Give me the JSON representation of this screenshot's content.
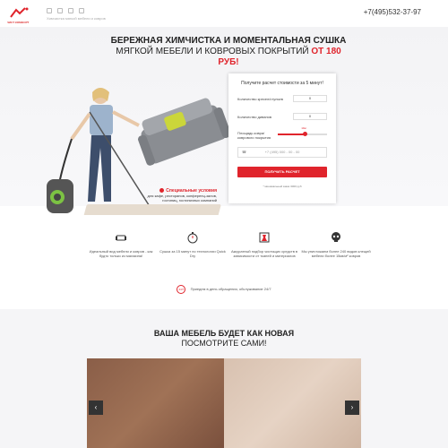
{
  "header": {
    "logo_text": "ЧИСТ КОМФОРТ",
    "tagline": "Химчистка мягкой мебели и ковров",
    "phone": "+7(495)532-37-97"
  },
  "hero": {
    "title_line1": "Бережная химчистка и моментальная сушка",
    "title_line2": "мягкой мебели и ковровых покрытий",
    "price": "от 180 руб!",
    "special_title": "Специальные условия",
    "special_text": "для кафе, ресторанов, конференц-залов, гостиниц, гостиничных компаний"
  },
  "form": {
    "title": "Получите расчет стоимости за 5 минут!",
    "row1_label": "Количество кресел/стульев",
    "row1_value": "0",
    "row2_label": "Количество диванов",
    "row2_value": "0",
    "row3_label": "Площадь ковра/ коврового покрытия",
    "slider_value": "10м",
    "slider_fraction": 0.55,
    "phone_placeholder": "+7 (495) 000 - 00 - 00",
    "button": "Получить расчет",
    "note": "* минимальный заказ 3000 руб"
  },
  "features": [
    {
      "icon": "sofa-icon",
      "text": "Идеальный вид мебели и ковров - как будто только из магазина!"
    },
    {
      "icon": "timer-icon",
      "text": "Сушка за 15 минут по технологии Quick Dry"
    },
    {
      "icon": "flask-icon",
      "text": "Аккуратный подбор чистящих средств в зависимости от тканей и материалов"
    },
    {
      "icon": "skull-icon",
      "text": "Мы уничтожаем более 240 видов клещей мебели более 15кв/м² ковров"
    }
  ],
  "badge": {
    "icon_text": "24/7",
    "text": "Приедем в день обращения, обслуживание 24/7"
  },
  "section2": {
    "title_line1": "Ваша мебель будет как новая",
    "title_line2": "посмотрите сами!",
    "prev": "‹",
    "next": "›"
  },
  "colors": {
    "accent": "#e0242c"
  }
}
